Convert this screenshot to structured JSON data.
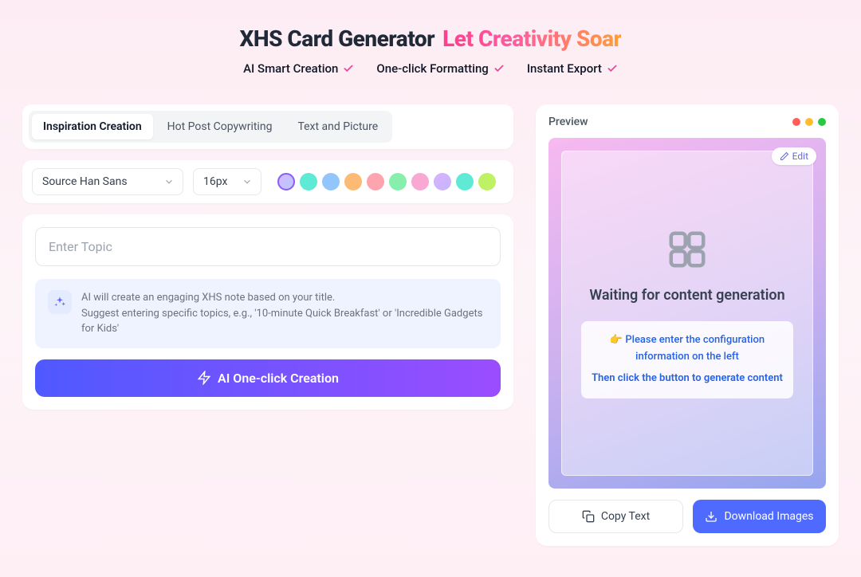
{
  "header": {
    "title": "XHS Card Generator",
    "subtitle": "Let Creativity Soar",
    "features": [
      "AI Smart Creation",
      "One-click Formatting",
      "Instant Export"
    ]
  },
  "tabs": {
    "items": [
      "Inspiration Creation",
      "Hot Post Copywriting",
      "Text and Picture"
    ],
    "active_index": 0
  },
  "style": {
    "font_select": "Source Han Sans",
    "size_select": "16px",
    "swatch_colors": [
      "linear-gradient(135deg,#d5b8ff,#b8c7ff)",
      "#5eead4",
      "#93c5fd",
      "#fdba74",
      "#fda4af",
      "#86efac",
      "#f9a8d4",
      "linear-gradient(135deg,#d8b4fe,#c4b5fd)",
      "#5eead4",
      "#bef264"
    ],
    "selected_swatch": 0
  },
  "editor": {
    "topic_placeholder": "Enter Topic",
    "hint_line1": "AI will create an engaging XHS note based on your title.",
    "hint_line2": "Suggest entering specific topics, e.g., '10-minute Quick Breakfast' or 'Incredible Gadgets for Kids'",
    "primary_button": "AI One-click Creation"
  },
  "preview": {
    "label": "Preview",
    "edit_label": "Edit",
    "placeholder_title": "Waiting for content generation",
    "instruction_emoji": "👉",
    "instruction1": "Please enter the configuration information on the left",
    "instruction2": "Then click the button to generate content",
    "copy_button": "Copy Text",
    "download_button": "Download Images"
  }
}
